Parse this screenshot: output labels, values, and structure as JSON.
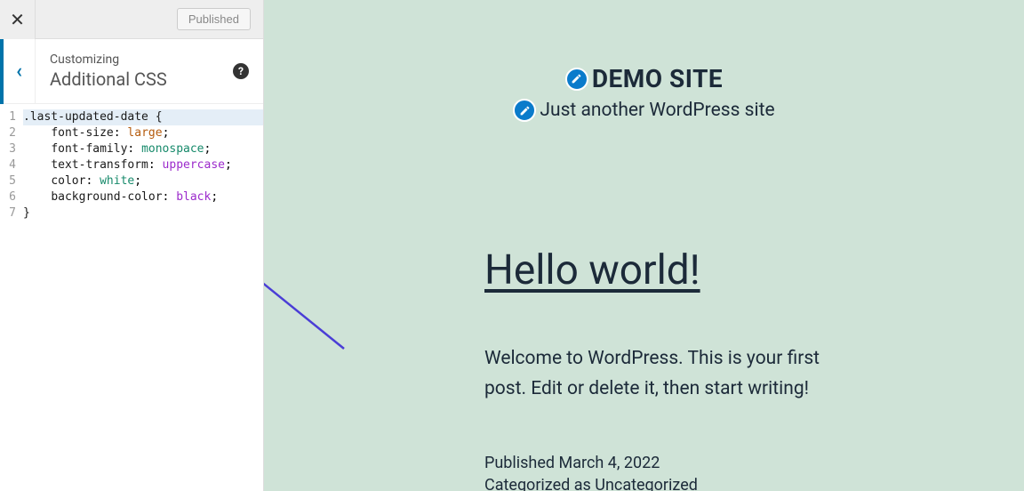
{
  "topbar": {
    "published_label": "Published"
  },
  "section": {
    "customizing_label": "Customizing",
    "name": "Additional CSS"
  },
  "code": {
    "lines": [
      {
        "n": "1",
        "segments": [
          {
            "t": ".last-updated-date {",
            "c": "tok-sel"
          }
        ],
        "active": true
      },
      {
        "n": "2",
        "segments": [
          {
            "t": "    ",
            "c": ""
          },
          {
            "t": "font-size",
            "c": "tok-prop"
          },
          {
            "t": ": ",
            "c": ""
          },
          {
            "t": "large",
            "c": "tok-val-kw"
          },
          {
            "t": ";",
            "c": ""
          }
        ]
      },
      {
        "n": "3",
        "segments": [
          {
            "t": "    ",
            "c": ""
          },
          {
            "t": "font-family",
            "c": "tok-prop"
          },
          {
            "t": ": ",
            "c": ""
          },
          {
            "t": "monospace",
            "c": "tok-val-mono"
          },
          {
            "t": ";",
            "c": ""
          }
        ]
      },
      {
        "n": "4",
        "segments": [
          {
            "t": "    ",
            "c": ""
          },
          {
            "t": "text-transform",
            "c": "tok-prop"
          },
          {
            "t": ": ",
            "c": ""
          },
          {
            "t": "uppercase",
            "c": "tok-val-upper"
          },
          {
            "t": ";",
            "c": ""
          }
        ]
      },
      {
        "n": "5",
        "segments": [
          {
            "t": "    ",
            "c": ""
          },
          {
            "t": "color",
            "c": "tok-prop"
          },
          {
            "t": ": ",
            "c": ""
          },
          {
            "t": "white",
            "c": "tok-val-white"
          },
          {
            "t": ";",
            "c": ""
          }
        ]
      },
      {
        "n": "6",
        "segments": [
          {
            "t": "    ",
            "c": ""
          },
          {
            "t": "background-color",
            "c": "tok-prop"
          },
          {
            "t": ": ",
            "c": ""
          },
          {
            "t": "black",
            "c": "tok-val-black"
          },
          {
            "t": ";",
            "c": ""
          }
        ]
      },
      {
        "n": "7",
        "segments": [
          {
            "t": "}",
            "c": "tok-sel"
          }
        ]
      }
    ]
  },
  "preview": {
    "site_title": "DEMO SITE",
    "tagline": "Just another WordPress site",
    "post_title": "Hello world!",
    "post_body": "Welcome to WordPress. This is your first post. Edit or delete it, then start writing!",
    "published_prefix": "Published ",
    "published_date": "March 4, 2022",
    "categorized_prefix": "Categorized as ",
    "category": "Uncategorized"
  }
}
